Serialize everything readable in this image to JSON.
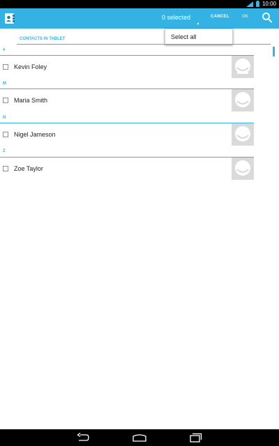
{
  "status_bar": {
    "time": "10:00"
  },
  "action_bar": {
    "selected": "0 selected",
    "cancel": "CANCEL",
    "ok": "OK",
    "accent": "#34b2e3"
  },
  "menu": {
    "items": [
      "Select all"
    ]
  },
  "section": {
    "header": "CONTACTS IN TABLET"
  },
  "groups": [
    {
      "letter": "#",
      "contact": "Kevin Foley"
    },
    {
      "letter": "M",
      "contact": "Maria Smith"
    },
    {
      "letter": "N",
      "contact": "Nigel Jameson"
    },
    {
      "letter": "Z",
      "contact": "Zoe Taylor"
    }
  ],
  "icons": {
    "app": "contacts-icon",
    "search": "search-icon",
    "back": "back-icon",
    "home": "home-icon",
    "recents": "recents-icon",
    "wifi": "wifi-signal-icon",
    "battery": "battery-icon"
  }
}
